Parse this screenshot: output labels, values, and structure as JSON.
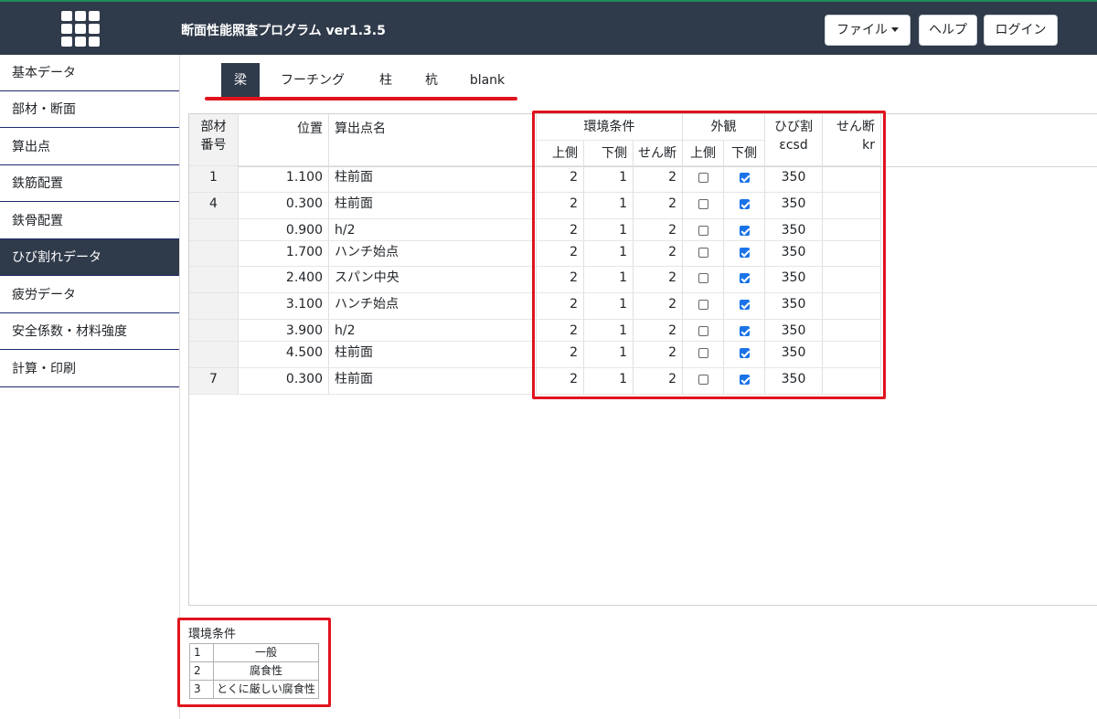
{
  "header": {
    "title": "断面性能照査プログラム ver1.3.5",
    "file_button": "ファイル",
    "help_button": "ヘルプ",
    "login_button": "ログイン"
  },
  "sidebar": {
    "items": [
      {
        "label": "基本データ"
      },
      {
        "label": "部材・断面"
      },
      {
        "label": "算出点"
      },
      {
        "label": "鉄筋配置"
      },
      {
        "label": "鉄骨配置"
      },
      {
        "label": "ひび割れデータ"
      },
      {
        "label": "疲労データ"
      },
      {
        "label": "安全係数・材料強度"
      },
      {
        "label": "計算・印刷"
      }
    ],
    "active_index": 5
  },
  "tabs": [
    {
      "label": "梁"
    },
    {
      "label": "フーチング"
    },
    {
      "label": "柱"
    },
    {
      "label": "杭"
    },
    {
      "label": "blank"
    }
  ],
  "table": {
    "headers": {
      "member_no_1": "部材",
      "member_no_2": "番号",
      "position": "位置",
      "point_name": "算出点名",
      "env_group": "環境条件",
      "env_upper": "上側",
      "env_lower": "下側",
      "env_shear": "せん断",
      "appearance_group": "外観",
      "app_upper": "上側",
      "app_lower": "下側",
      "crack_1": "ひび割",
      "crack_2": "εcsd",
      "shear_kr_1": "せん断",
      "shear_kr_2": "kr"
    },
    "rows": [
      {
        "member": "1",
        "position": "1.100",
        "name": "柱前面",
        "env_upper": "2",
        "env_lower": "1",
        "env_shear": "2",
        "app_upper": false,
        "app_lower": true,
        "ecsd": "350",
        "kr": ""
      },
      {
        "member": "4",
        "position": "0.300",
        "name": "柱前面",
        "env_upper": "2",
        "env_lower": "1",
        "env_shear": "2",
        "app_upper": false,
        "app_lower": true,
        "ecsd": "350",
        "kr": ""
      },
      {
        "member": "",
        "position": "0.900",
        "name": "h/2",
        "env_upper": "2",
        "env_lower": "1",
        "env_shear": "2",
        "app_upper": false,
        "app_lower": true,
        "ecsd": "350",
        "kr": ""
      },
      {
        "member": "",
        "position": "1.700",
        "name": "ハンチ始点",
        "env_upper": "2",
        "env_lower": "1",
        "env_shear": "2",
        "app_upper": false,
        "app_lower": true,
        "ecsd": "350",
        "kr": ""
      },
      {
        "member": "",
        "position": "2.400",
        "name": "スパン中央",
        "env_upper": "2",
        "env_lower": "1",
        "env_shear": "2",
        "app_upper": false,
        "app_lower": true,
        "ecsd": "350",
        "kr": ""
      },
      {
        "member": "",
        "position": "3.100",
        "name": "ハンチ始点",
        "env_upper": "2",
        "env_lower": "1",
        "env_shear": "2",
        "app_upper": false,
        "app_lower": true,
        "ecsd": "350",
        "kr": ""
      },
      {
        "member": "",
        "position": "3.900",
        "name": "h/2",
        "env_upper": "2",
        "env_lower": "1",
        "env_shear": "2",
        "app_upper": false,
        "app_lower": true,
        "ecsd": "350",
        "kr": ""
      },
      {
        "member": "",
        "position": "4.500",
        "name": "柱前面",
        "env_upper": "2",
        "env_lower": "1",
        "env_shear": "2",
        "app_upper": false,
        "app_lower": true,
        "ecsd": "350",
        "kr": ""
      },
      {
        "member": "7",
        "position": "0.300",
        "name": "柱前面",
        "env_upper": "2",
        "env_lower": "1",
        "env_shear": "2",
        "app_upper": false,
        "app_lower": true,
        "ecsd": "350",
        "kr": ""
      }
    ]
  },
  "legend": {
    "title": "環境条件",
    "rows": [
      {
        "no": "1",
        "label": "一般"
      },
      {
        "no": "2",
        "label": "腐食性"
      },
      {
        "no": "3",
        "label": "とくに厳しい腐食性"
      }
    ]
  },
  "colors": {
    "header_bg": "#2f3a4a",
    "highlight_red": "#e0131d",
    "checkbox_checked": "#1a73e8"
  }
}
